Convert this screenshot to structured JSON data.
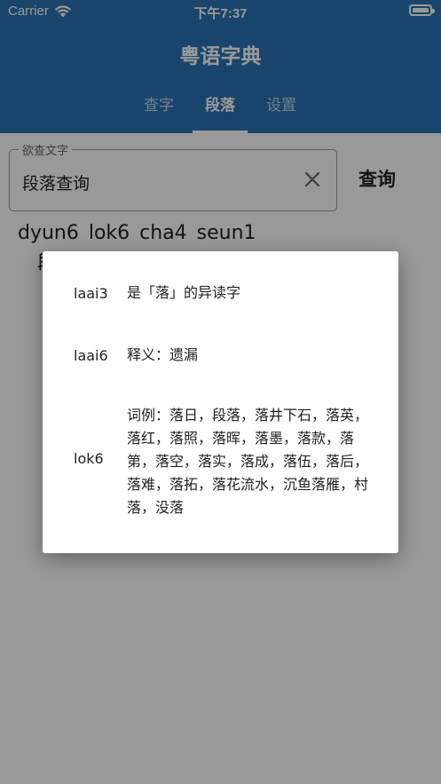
{
  "status_bar": {
    "carrier": "Carrier",
    "time": "下午7:37"
  },
  "app": {
    "title": "粤语字典"
  },
  "tabs": [
    {
      "label": "查字",
      "active": false
    },
    {
      "label": "段落",
      "active": true
    },
    {
      "label": "设置",
      "active": false
    }
  ],
  "search": {
    "label": "欲查文字",
    "value": "段落查询",
    "button_label": "查询"
  },
  "result": {
    "pinyin_line": "dyun6  lok6  cha4  seun1",
    "partial_char": "段"
  },
  "dialog": {
    "rows": [
      {
        "jyutping": "laai3",
        "meaning": "是「落」的异读字"
      },
      {
        "jyutping": "laai6",
        "meaning": "释义：遗漏"
      },
      {
        "jyutping": "lok6",
        "meaning": "词例：落日，段落，落井下石，落英，落红，落照，落晖，落墨，落款，落第，落空，落实，落成，落伍，落后，落难，落拓，落花流水，沉鱼落雁，村落，没落"
      }
    ]
  },
  "colors": {
    "primary": "#2a73b5",
    "scrim": "rgba(0,0,0,0.4)"
  },
  "icons": [
    "wifi-icon",
    "battery-icon",
    "clear-icon"
  ]
}
